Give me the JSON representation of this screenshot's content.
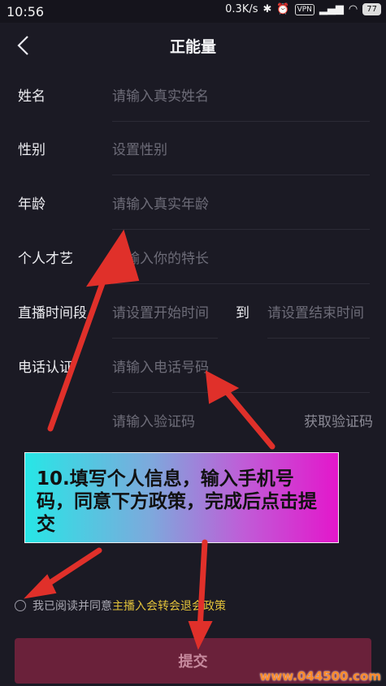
{
  "status_bar": {
    "time": "10:56",
    "network_speed": "0.3K/s",
    "vpn": "VPN",
    "battery": "77"
  },
  "nav": {
    "title": "正能量"
  },
  "form": {
    "name": {
      "label": "姓名",
      "placeholder": "请输入真实姓名"
    },
    "gender": {
      "label": "性别",
      "placeholder": "设置性别"
    },
    "age": {
      "label": "年龄",
      "placeholder": "请输入真实年龄"
    },
    "talent": {
      "label": "个人才艺",
      "placeholder": "请输入你的特长"
    },
    "live_time": {
      "label": "直播时间段",
      "start_placeholder": "请设置开始时间",
      "to": "到",
      "end_placeholder": "请设置结束时间"
    },
    "phone": {
      "label": "电话认证",
      "placeholder": "请输入电话号码"
    },
    "code": {
      "placeholder": "请输入验证码",
      "button": "获取验证码"
    }
  },
  "banner": {
    "text": "10.填写个人信息，输入手机号码，同意下方政策，完成后点击提交"
  },
  "agreement": {
    "prefix": "我已阅读并同意",
    "policy": "主播入会转会退会政策"
  },
  "submit": {
    "label": "提交"
  },
  "watermark": "www.044500.com",
  "colors": {
    "background": "#1b1a24",
    "submit": "#6a213a",
    "policy": "#e2c23a",
    "arrow": "#e0302a"
  }
}
